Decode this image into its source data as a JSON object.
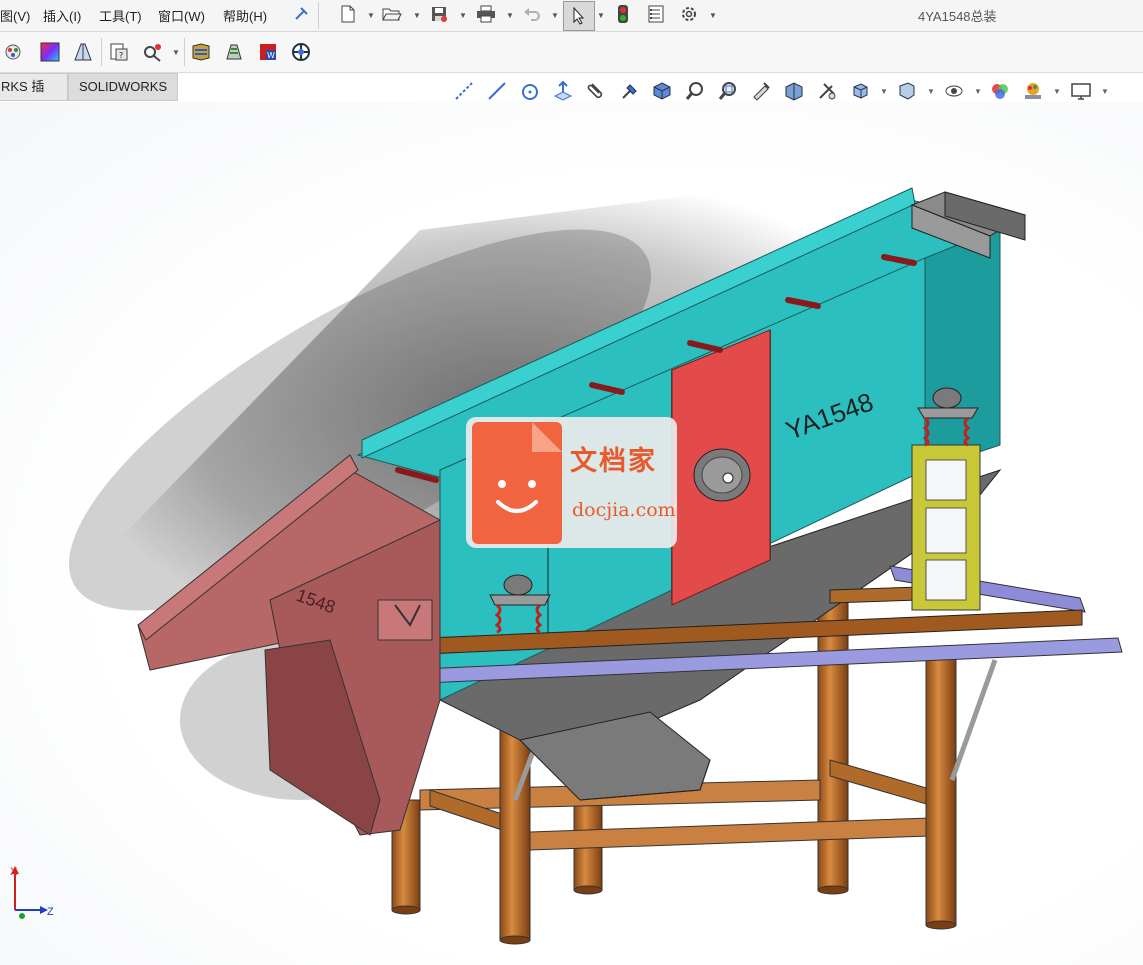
{
  "menu": {
    "items": [
      "图(V)",
      "插入(I)",
      "工具(T)",
      "窗口(W)",
      "帮助(H)"
    ]
  },
  "window": {
    "title": "4YA1548总装"
  },
  "tabs": [
    "RKS 插件",
    "SOLIDWORKS MBD"
  ],
  "model": {
    "label": "YA1548",
    "side_label": "1548"
  },
  "watermark": {
    "cn": "文档家",
    "en": "docjia.com"
  },
  "triad": {
    "x": "X",
    "z": "Z"
  },
  "colors": {
    "screen": "#2bbfbf",
    "screen_dark": "#1c9c9c",
    "panel_red": "#e34b4b",
    "feed_chute": "#b86767",
    "frame_orange": "#c07030",
    "walkway": "#8c8cd8",
    "spring_post": "#c8c838",
    "hopper_grey": "#707070"
  },
  "icons": {
    "menubar": [
      "pin-icon",
      "new-document-icon",
      "open-icon",
      "save-icon",
      "print-icon",
      "undo-icon",
      "select-icon",
      "rebuild-icon",
      "file-properties-icon",
      "options-icon"
    ],
    "toolbar2": [
      "addin-icon",
      "appearance-icon",
      "section-icon",
      "measure-icon",
      "evaluate-icon",
      "simulation-icon",
      "flow-icon",
      "word-icon",
      "spin-icon"
    ],
    "hud": [
      "sketch-line-icon",
      "line-icon",
      "circle-icon",
      "normal-to-icon",
      "clip-icon",
      "magnet-icon",
      "view-cube-icon",
      "zoom-fit-icon",
      "zoom-area-icon",
      "previous-view-icon",
      "section-view-icon",
      "dynamic-annotation-icon",
      "view-orientation-icon",
      "display-style-icon",
      "hide-show-icon",
      "edit-appearance-icon",
      "apply-scene-icon",
      "view-settings-icon"
    ]
  }
}
